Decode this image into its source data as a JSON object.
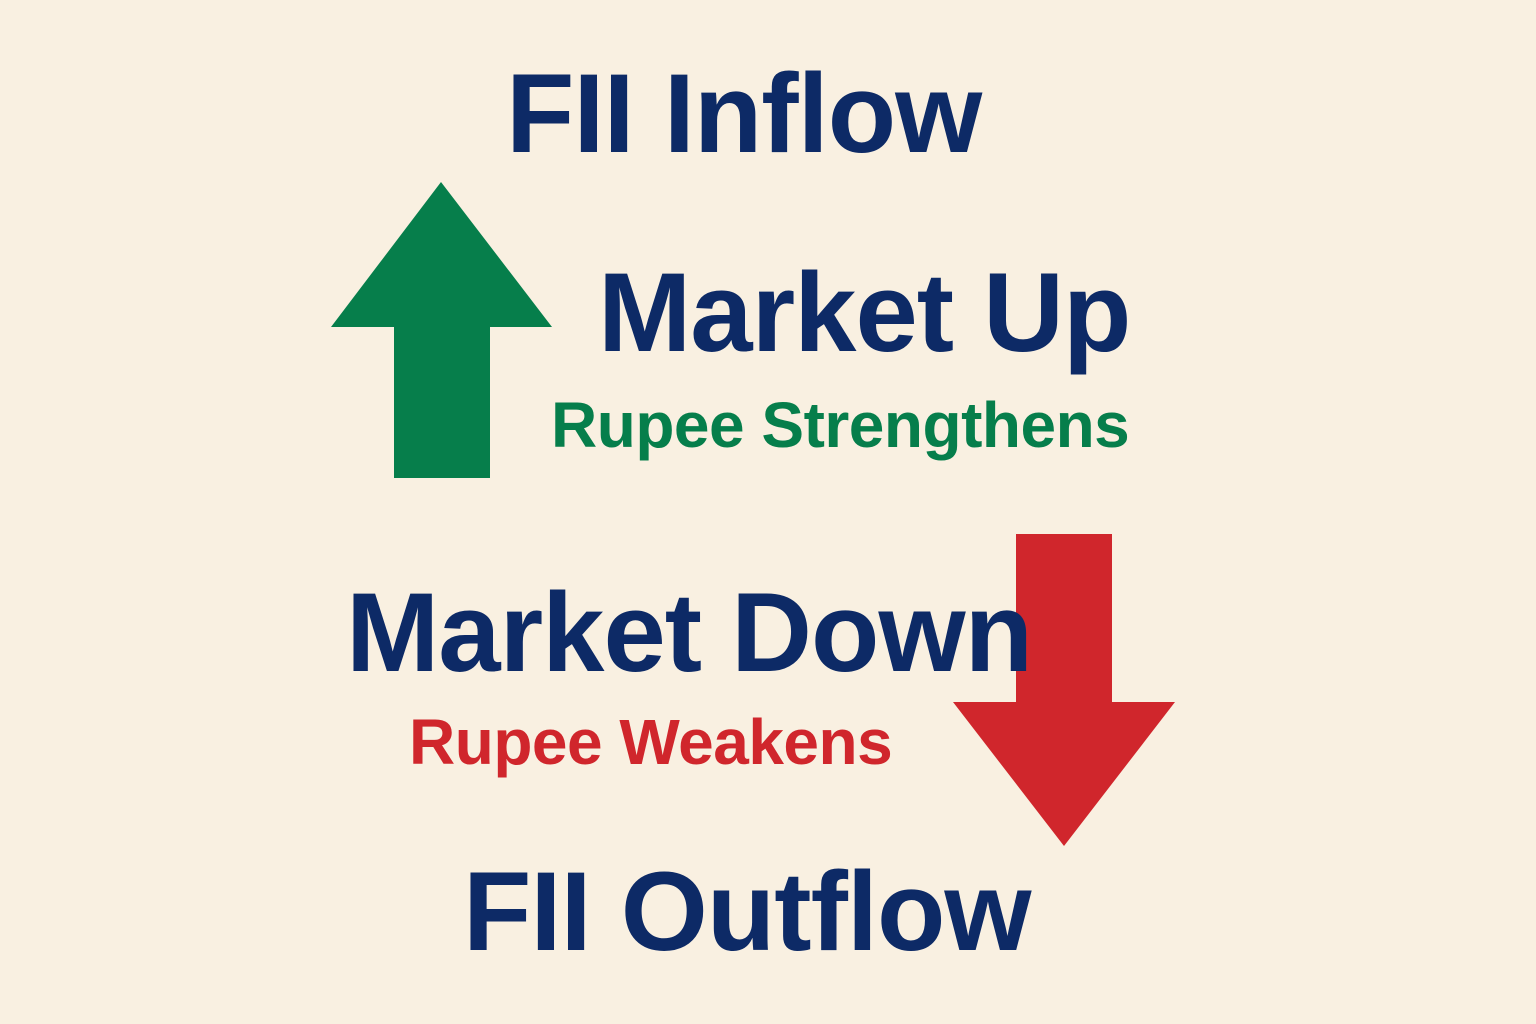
{
  "labels": {
    "fii_inflow": "FII Inflow",
    "market_up": "Market Up",
    "rupee_strengthens": "Rupee Strengthens",
    "market_down": "Market Down",
    "rupee_weakens": "Rupee Weakens",
    "fii_outflow": "FII Outflow"
  },
  "icons": {
    "up": "arrow-up-icon",
    "down": "arrow-down-icon"
  },
  "colors": {
    "background": "#f9f0e1",
    "heading": "#0d2a66",
    "positive": "#067e4b",
    "negative": "#d0262c"
  }
}
